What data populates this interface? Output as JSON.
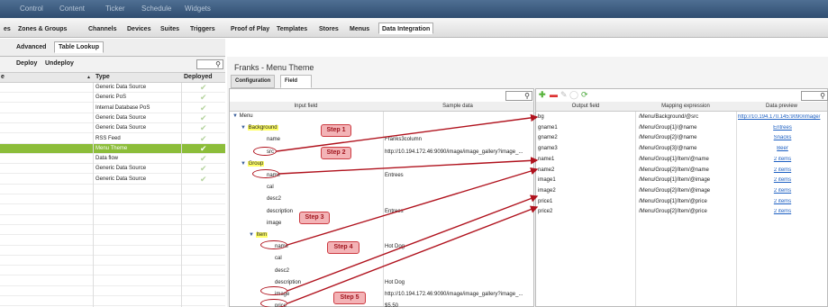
{
  "topnav": [
    "Control",
    "Content",
    "Ticker",
    "Schedule",
    "Widgets"
  ],
  "subnav": [
    "es",
    "Zones & Groups",
    "Channels",
    "Devices",
    "Suites",
    "Triggers",
    "Proof of Play",
    "Templates",
    "Stores",
    "Menus",
    "Data Integration"
  ],
  "left": {
    "tabs": [
      "Advanced",
      "Table Lookup"
    ],
    "actions": [
      "Deploy",
      "Undeploy"
    ],
    "headers": {
      "name": "e",
      "type": "Type",
      "deployed": "Deployed"
    },
    "rows": [
      {
        "type": "Generic Data Source"
      },
      {
        "type": "Generic PoS"
      },
      {
        "type": "Internal Database PoS"
      },
      {
        "type": "Generic Data Source"
      },
      {
        "type": "Generic Data Source"
      },
      {
        "type": "RSS Feed"
      },
      {
        "type": "Menu Theme",
        "selected": true
      },
      {
        "type": "Data flow"
      },
      {
        "type": "Generic Data Source"
      },
      {
        "type": "Generic Data Source"
      }
    ]
  },
  "panel": {
    "title": "Franks - Menu Theme",
    "tabs": [
      "Configuration",
      "Field mapping"
    ]
  },
  "input_grid": {
    "headers": [
      "Input field",
      "Sample data"
    ],
    "rows": [
      {
        "label": "Menu",
        "sample": "",
        "level": 0,
        "expander": "▼",
        "highlight": false
      },
      {
        "label": "Background",
        "sample": "",
        "level": 1,
        "expander": "▼",
        "highlight": true
      },
      {
        "label": "name",
        "sample": "Franks3column",
        "level": 2,
        "expander": "",
        "highlight": false
      },
      {
        "label": "src",
        "sample": "http://10.194.172.46:9090/image/image_gallery?image_...",
        "level": 2,
        "expander": "",
        "highlight": false
      },
      {
        "label": "Group",
        "sample": "",
        "level": 1,
        "expander": "▼",
        "highlight": true
      },
      {
        "label": "name",
        "sample": "Entrees",
        "level": 2,
        "expander": "",
        "highlight": false
      },
      {
        "label": "cal",
        "sample": "",
        "level": 2,
        "expander": "",
        "highlight": false
      },
      {
        "label": "desc2",
        "sample": "",
        "level": 2,
        "expander": "",
        "highlight": false
      },
      {
        "label": "description",
        "sample": "Entrees",
        "level": 2,
        "expander": "",
        "highlight": false
      },
      {
        "label": "image",
        "sample": "",
        "level": 2,
        "expander": "",
        "highlight": false
      },
      {
        "label": "Item",
        "sample": "",
        "level": 2,
        "expander": "▼",
        "highlight": true
      },
      {
        "label": "name",
        "sample": "Hot Dog",
        "level": 3,
        "expander": "",
        "highlight": false
      },
      {
        "label": "cal",
        "sample": "",
        "level": 3,
        "expander": "",
        "highlight": false
      },
      {
        "label": "desc2",
        "sample": "",
        "level": 3,
        "expander": "",
        "highlight": false
      },
      {
        "label": "description",
        "sample": "Hot Dog",
        "level": 3,
        "expander": "",
        "highlight": false
      },
      {
        "label": "image",
        "sample": "http://10.194.172.46:9090/image/image_gallery?image_...",
        "level": 3,
        "expander": "",
        "highlight": false
      },
      {
        "label": "price",
        "sample": "$5.50",
        "level": 3,
        "expander": "",
        "highlight": false
      }
    ]
  },
  "output_grid": {
    "headers": [
      "Output field",
      "Mapping expression",
      "Data preview"
    ],
    "rows": [
      {
        "field": "bg",
        "expr": "/Menu/Background/@src",
        "preview": "http://10.194.170.145:9090/image/"
      },
      {
        "field": "gname1",
        "expr": "/Menu/Group[1]/@name",
        "preview": "Entrees"
      },
      {
        "field": "gname2",
        "expr": "/Menu/Group[2]/@name",
        "preview": "Snacks"
      },
      {
        "field": "gname3",
        "expr": "/Menu/Group[3]/@name",
        "preview": "Beer"
      },
      {
        "field": "name1",
        "expr": "/Menu/Group[1]/Item/@name",
        "preview": "2 items"
      },
      {
        "field": "name2",
        "expr": "/Menu/Group[2]/Item/@name",
        "preview": "2 items"
      },
      {
        "field": "image1",
        "expr": "/Menu/Group[1]/Item/@image",
        "preview": "2 items"
      },
      {
        "field": "image2",
        "expr": "/Menu/Group[2]/Item/@image",
        "preview": "2 items"
      },
      {
        "field": "price1",
        "expr": "/Menu/Group[1]/Item/@price",
        "preview": "2 items"
      },
      {
        "field": "price2",
        "expr": "/Menu/Group[2]/Item/@price",
        "preview": "2 items"
      }
    ]
  },
  "toolbar_icons": [
    "add-icon",
    "remove-icon",
    "edit-icon",
    "clear-icon",
    "refresh-icon"
  ],
  "callouts": [
    "Step 1",
    "Step 2",
    "Step 3",
    "Step 4",
    "Step 5"
  ],
  "colors": {
    "accent_green": "#8cbd3a",
    "arrow_red": "#b0121d",
    "highlight_yellow": "#ffff66",
    "nav_blue": "#3a5a80"
  }
}
